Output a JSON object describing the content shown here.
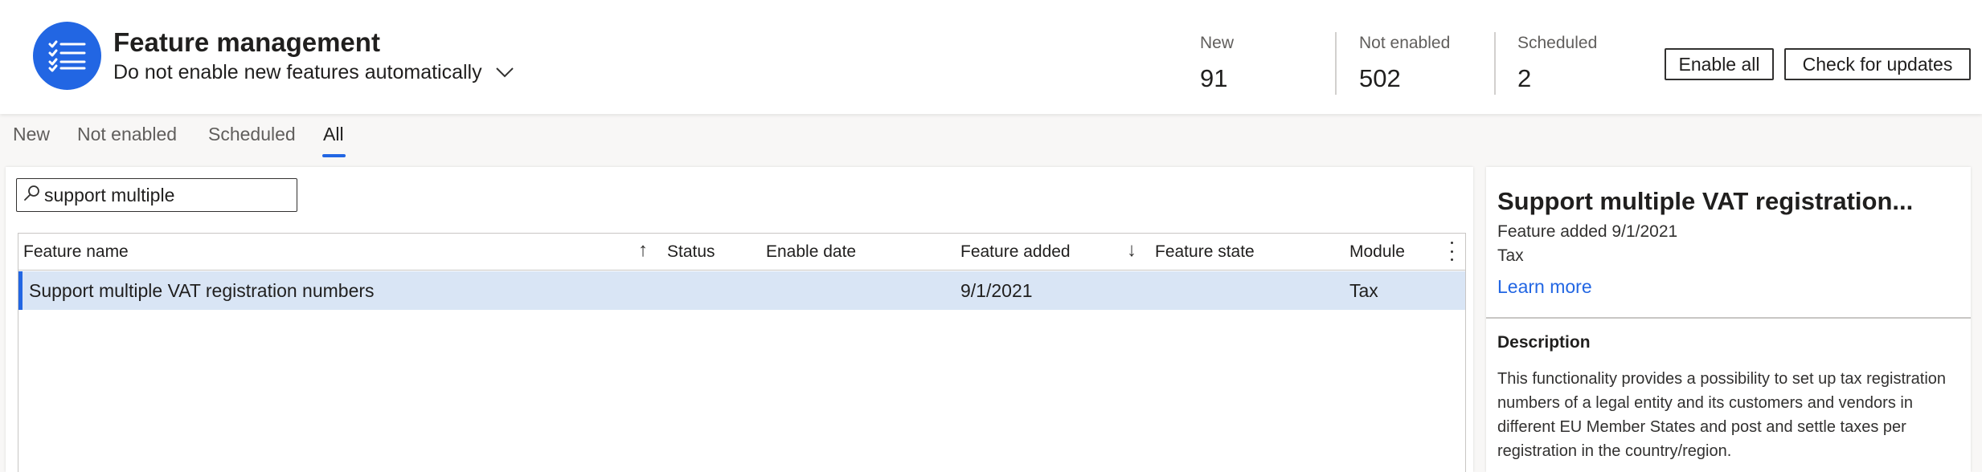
{
  "header": {
    "title": "Feature management",
    "subtitle": "Do not enable new features automatically",
    "stats": [
      {
        "label": "New",
        "value": "91"
      },
      {
        "label": "Not enabled",
        "value": "502"
      },
      {
        "label": "Scheduled",
        "value": "2"
      }
    ],
    "enable_all_label": "Enable all",
    "check_updates_label": "Check for updates",
    "accent_color": "#2266e3"
  },
  "tabs": [
    {
      "label": "New",
      "active": false
    },
    {
      "label": "Not enabled",
      "active": false
    },
    {
      "label": "Scheduled",
      "active": false
    },
    {
      "label": "All",
      "active": true
    }
  ],
  "search": {
    "value": "support multiple",
    "icon": "search-icon"
  },
  "grid": {
    "columns": [
      "Feature name",
      "Status",
      "Enable date",
      "Feature added",
      "Feature state",
      "Module"
    ],
    "sort": {
      "feature_name": "ascending",
      "feature_added": "descending"
    },
    "rows": [
      {
        "feature_name": "Support multiple VAT registration numbers",
        "status": "",
        "enable_date": "",
        "feature_added": "9/1/2021",
        "feature_state": "",
        "module": "Tax",
        "selected": true
      }
    ],
    "selected_row_color": "#d9e5f5"
  },
  "details": {
    "title": "Support multiple VAT registration...",
    "feature_added": "Feature added 9/1/2021",
    "module": "Tax",
    "learn_more": "Learn more",
    "description_heading": "Description",
    "description": "This functionality provides a possibility to set up tax registration numbers of a legal entity and its customers and vendors in different EU Member States and post and settle taxes per registration in the country/region."
  }
}
